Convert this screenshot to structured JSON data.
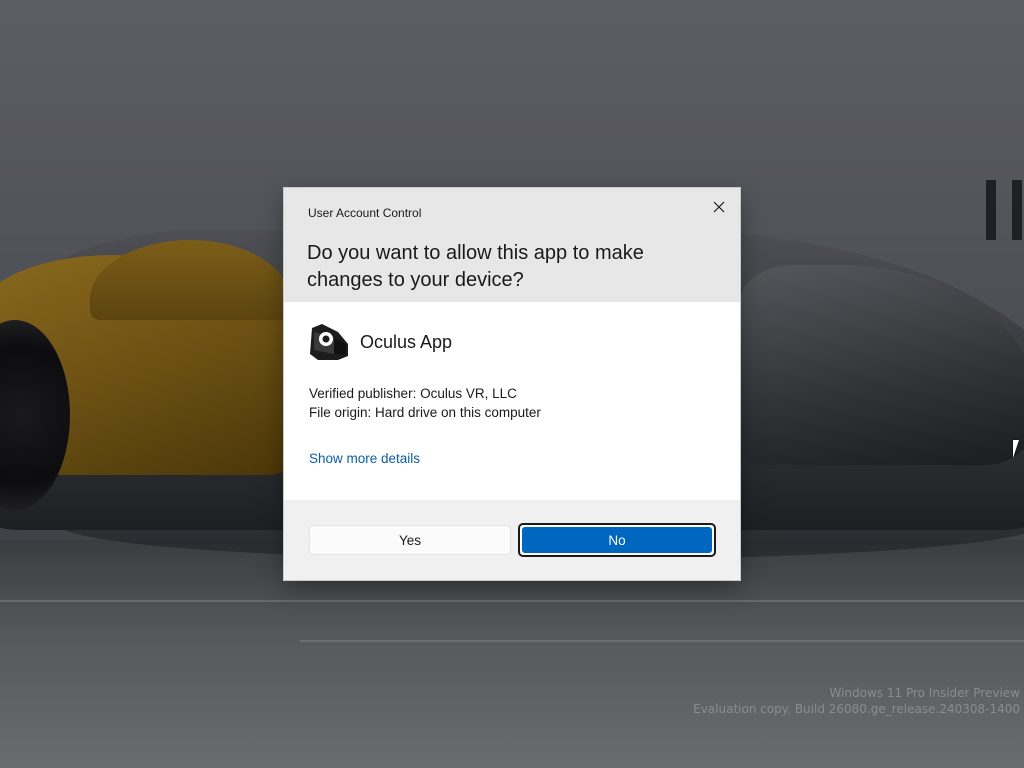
{
  "dialog": {
    "title": "User Account Control",
    "question": "Do you want to allow this app to make changes to your device?",
    "app_name": "Oculus App",
    "app_icon": "oculus-app-icon",
    "publisher": "Verified publisher: Oculus VR, LLC",
    "file_origin": "File origin: Hard drive on this computer",
    "details_link": "Show more details",
    "yes_label": "Yes",
    "no_label": "No",
    "close_icon": "close-icon"
  },
  "watermark": {
    "line1": "Windows 11 Pro Insider Preview",
    "line2": "Evaluation copy. Build 26080.ge_release.240308-1400"
  },
  "colors": {
    "accent": "#0067c0",
    "link": "#0a5ea8",
    "header_bg": "#e7e7e7",
    "footer_bg": "#f0f0f0"
  }
}
